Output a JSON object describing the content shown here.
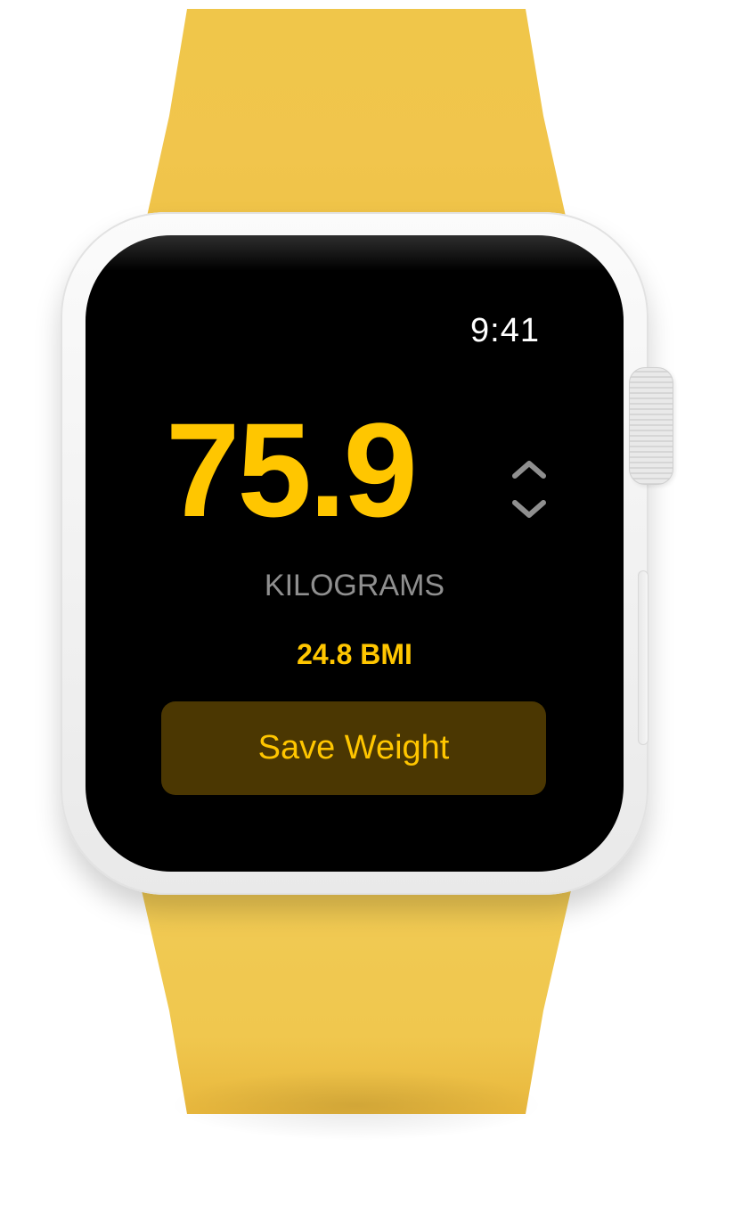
{
  "status_bar": {
    "time": "9:41"
  },
  "weight": {
    "value": "75.9",
    "unit": "KILOGRAMS",
    "stepper_icon": "chevron-up-down-icon"
  },
  "bmi": {
    "label": "24.8 BMI"
  },
  "actions": {
    "save_label": "Save Weight"
  },
  "colors": {
    "accent": "#ffc600",
    "button_bg": "#4b3702",
    "secondary_text": "#8f8f8f",
    "band": "#f0c64a",
    "screen": "#000000"
  }
}
